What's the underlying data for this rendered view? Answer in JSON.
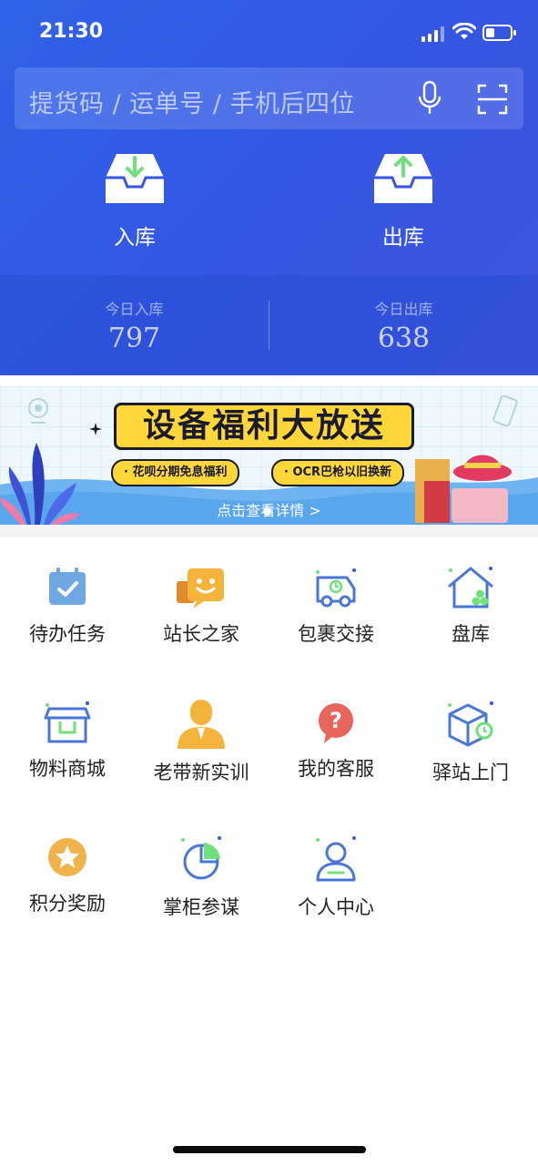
{
  "status": {
    "time": "21:30"
  },
  "search": {
    "placeholder": "提货码 / 运单号 / 手机后四位"
  },
  "actions": {
    "inbound": "入库",
    "outbound": "出库"
  },
  "stats": {
    "inbound_label": "今日入库",
    "inbound_value": "797",
    "outbound_label": "今日出库",
    "outbound_value": "638"
  },
  "banner": {
    "title": "设备福利大放送",
    "pill1": "· 花呗分期免息福利",
    "pill2": "· OCR巴枪以旧换新",
    "link": "点击查看详情 >"
  },
  "menu": [
    {
      "label": "待办任务",
      "icon": "todo-icon"
    },
    {
      "label": "站长之家",
      "icon": "station-master-icon"
    },
    {
      "label": "包裹交接",
      "icon": "delivery-truck-icon"
    },
    {
      "label": "盘库",
      "icon": "house-inventory-icon"
    },
    {
      "label": "物料商城",
      "icon": "store-icon"
    },
    {
      "label": "老带新实训",
      "icon": "trainer-icon"
    },
    {
      "label": "我的客服",
      "icon": "help-icon"
    },
    {
      "label": "驿站上门",
      "icon": "package-pickup-icon"
    },
    {
      "label": "积分奖励",
      "icon": "star-reward-icon"
    },
    {
      "label": "掌柜参谋",
      "icon": "pie-chart-icon"
    },
    {
      "label": "个人中心",
      "icon": "user-icon"
    }
  ],
  "colors": {
    "brand_blue": "#3556e3",
    "accent_green": "#6fe07a",
    "accent_orange": "#f4b43c",
    "banner_yellow": "#ffd73a"
  }
}
